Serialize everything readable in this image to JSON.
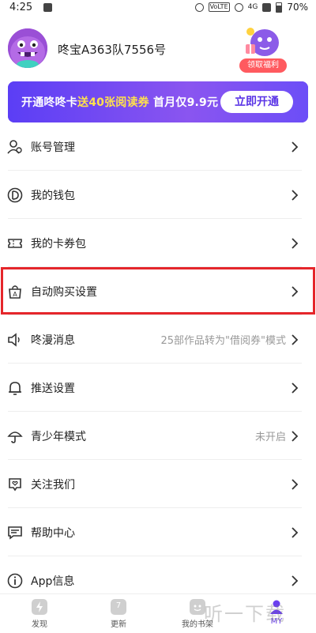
{
  "status_bar": {
    "time": "4:25",
    "network_tag": "VoLTE",
    "signal_label": "4G",
    "battery": "70%"
  },
  "profile": {
    "username": "咚宝A363队7556号",
    "welfare_label": "领取福利"
  },
  "banner": {
    "text_prefix": "开通咚咚卡",
    "text_highlight": "送40张阅读券",
    "text_suffix": " 首月仅9.9元",
    "button_label": "立即开通",
    "colors": {
      "background": "#6a3ff0",
      "highlight": "#ffe14d"
    }
  },
  "menu": {
    "items": [
      {
        "label": "账号管理",
        "icon": "account-icon"
      },
      {
        "label": "我的钱包",
        "icon": "wallet-icon"
      },
      {
        "label": "我的卡券包",
        "icon": "coupon-icon"
      },
      {
        "label": "自动购买设置",
        "icon": "auto-buy-icon"
      },
      {
        "label": "咚漫消息",
        "icon": "speaker-icon",
        "value": "25部作品转为\"借阅券\"模式"
      },
      {
        "label": "推送设置",
        "icon": "bell-icon"
      },
      {
        "label": "青少年模式",
        "icon": "umbrella-icon",
        "value": "未开启"
      },
      {
        "label": "关注我们",
        "icon": "heart-card-icon"
      },
      {
        "label": "帮助中心",
        "icon": "chat-icon"
      },
      {
        "label": "App信息",
        "icon": "info-icon"
      }
    ]
  },
  "bottom_nav": {
    "items": [
      {
        "label": "发现",
        "icon": "discover-icon"
      },
      {
        "label": "更新",
        "icon": "calendar-icon",
        "badge": "7"
      },
      {
        "label": "我的书架",
        "icon": "bookshelf-icon"
      },
      {
        "label": "MY",
        "icon": "my-icon",
        "active": true
      }
    ]
  },
  "watermark": "听一下载",
  "accent_color": "#6a3ff0",
  "highlight_color": "#e5262b"
}
